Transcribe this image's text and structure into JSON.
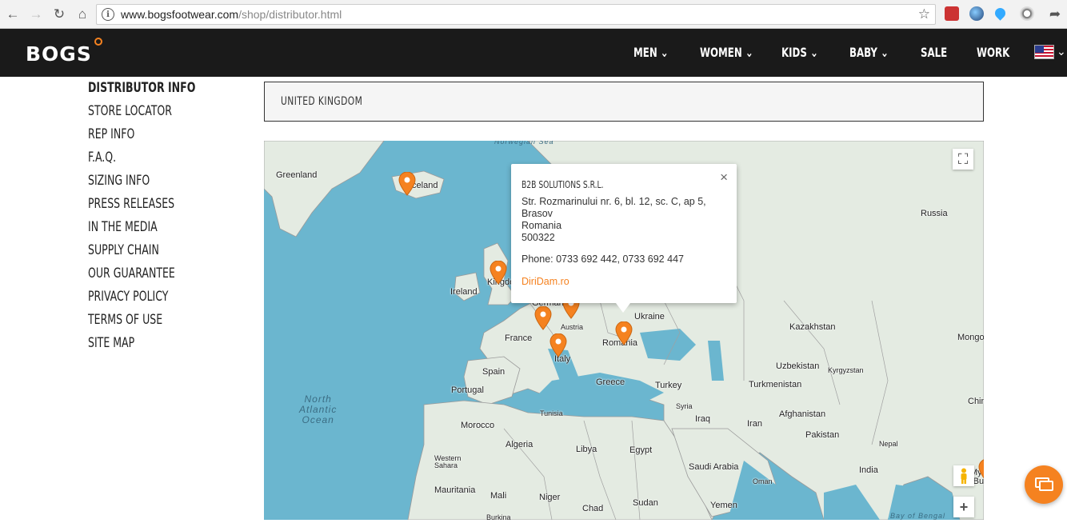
{
  "browser": {
    "url_domain": "www.bogsfootwear.com",
    "url_path": "/shop/distributor.html"
  },
  "brand": {
    "logo": "BOGS",
    "accent": "#f58220"
  },
  "nav": [
    {
      "label": "MEN",
      "caret": "⌄"
    },
    {
      "label": "WOMEN",
      "caret": "⌄"
    },
    {
      "label": "KIDS",
      "caret": "⌄"
    },
    {
      "label": "BABY",
      "caret": "⌄"
    },
    {
      "label": "SALE"
    },
    {
      "label": "WORK"
    }
  ],
  "sidebar": [
    {
      "label": "DISTRIBUTOR INFO",
      "active": true
    },
    {
      "label": "STORE LOCATOR"
    },
    {
      "label": "REP INFO"
    },
    {
      "label": "F.A.Q."
    },
    {
      "label": "SIZING INFO"
    },
    {
      "label": "PRESS RELEASES"
    },
    {
      "label": "IN THE MEDIA"
    },
    {
      "label": "SUPPLY CHAIN"
    },
    {
      "label": "OUR GUARANTEE"
    },
    {
      "label": "PRIVACY POLICY"
    },
    {
      "label": "TERMS OF USE"
    },
    {
      "label": "SITE MAP"
    }
  ],
  "country_select": {
    "value": "UNITED KINGDOM"
  },
  "infowindow": {
    "title": "B2B SOLUTIONS S.R.L.",
    "address_1": "Str. Rozmarinului nr. 6, bl. 12, sc. C, ap 5,",
    "city": "Brasov",
    "country": "Romania",
    "postcode": "500322",
    "phone": "Phone: 0733 692 442, 0733 692 447",
    "link": "DiriDam.ro",
    "close": "×"
  },
  "map_labels": {
    "greenland": "Greenland",
    "iceland": "Iceland",
    "norwegian_sea": "Norwegian Sea",
    "russia": "Russia",
    "ireland": "Ireland",
    "kingdom": "Kingdo",
    "germany": "German",
    "austria": "Austria",
    "ukraine": "Ukraine",
    "kazakhstan": "Kazakhstan",
    "mongolia": "Mongo",
    "france": "France",
    "romania": "Romania",
    "italy": "Italy",
    "spain": "Spain",
    "uzbekistan": "Uzbekistan",
    "kyrgyzstan": "Kyrgyzstan",
    "portugal": "Portugal",
    "greece": "Greece",
    "turkey": "Turkey",
    "turkmenistan": "Turkmenistan",
    "north_atlantic": "North\nAtlantic\nOcean",
    "syria": "Syria",
    "tunisia": "Tunisia",
    "iraq": "Iraq",
    "iran": "Iran",
    "afghanistan": "Afghanistan",
    "china": "Chin",
    "morocco": "Morocco",
    "pakistan": "Pakistan",
    "algeria": "Algeria",
    "nepal": "Nepal",
    "libya": "Libya",
    "egypt": "Egypt",
    "western_sahara": "Western\nSahara",
    "saudi": "Saudi Arabia",
    "india": "India",
    "myanmar": "Myanm\n(Burm",
    "oman": "Oman",
    "mauritania": "Mauritania",
    "mali": "Mali",
    "niger": "Niger",
    "sudan": "Sudan",
    "chad": "Chad",
    "yemen": "Yemen",
    "bay_bengal": "Bay of Bengal",
    "burkina": "Burkina"
  },
  "map_controls": {
    "fullscreen": "⛶",
    "zoom_in": "+"
  }
}
